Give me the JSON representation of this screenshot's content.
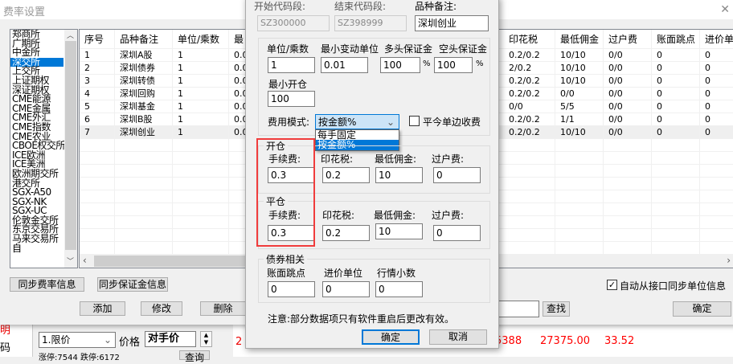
{
  "background": {
    "order_type": "1.限价",
    "price_label": "价格",
    "price_value": "对手价",
    "left_red": "明",
    "left_code": "码",
    "right_number": "2",
    "bottom_values": [
      "5388",
      "27375.00",
      "33.52"
    ],
    "query_label": "查询",
    "bottom_text": "涨停:7544 跌停:6172"
  },
  "window": {
    "title": "费率设置"
  },
  "exchanges": [
    "郑商所",
    "广期所",
    "中金所",
    "深交所",
    "上交所",
    "上证期权",
    "深证期权",
    "CME能源",
    "CME金属",
    "CME外汇",
    "CME指数",
    "CME农业",
    "CBOE权交所",
    "ICE欧洲",
    "ICE美洲",
    "欧洲期交所",
    "港交所",
    "SGX-A50",
    "SGX-NK",
    "SGX-UC",
    "伦敦金交所",
    "东京交易所",
    "马来交易所",
    "自"
  ],
  "selected_exchange": "深交所",
  "table": {
    "headers": [
      "序号",
      "品种备注",
      "单位/乘数",
      "最",
      "印花税",
      "最低佣金",
      "过户费",
      "账面跳点",
      "进价单"
    ],
    "rows": [
      [
        "1",
        "深圳A股",
        "1",
        "0.0",
        "0.2/0.2",
        "10/10",
        "0/0",
        "0",
        "0"
      ],
      [
        "2",
        "深圳债券",
        "1",
        "0.0",
        "2/0.2",
        "10/10",
        "0/0",
        "0",
        "0"
      ],
      [
        "3",
        "深圳转债",
        "1",
        "0.0",
        "0.2/0.2",
        "10/10",
        "0/0",
        "0",
        "0"
      ],
      [
        "4",
        "深圳回购",
        "1",
        "0.0",
        "0.2/0.2",
        "0/0",
        "0/0",
        "0",
        "0"
      ],
      [
        "5",
        "深圳基金",
        "1",
        "0.0",
        "0/0",
        "5/5",
        "0/0",
        "0",
        "0"
      ],
      [
        "6",
        "深圳B股",
        "1",
        "0.0",
        "0.2/0.2",
        "1/1",
        "0/0",
        "0",
        "0"
      ],
      [
        "7",
        "深圳创业",
        "1",
        "0.0",
        "0.2/0.2",
        "10/10",
        "0/0",
        "0",
        "0"
      ]
    ]
  },
  "buttons": {
    "sync_fee": "同步费率信息",
    "sync_margin": "同步保证金信息",
    "add": "添加",
    "modify": "修改",
    "delete": "删除",
    "find": "查找",
    "ok": "确定"
  },
  "auto_sync": {
    "label": "自动从接口同步单位信息",
    "checked": true
  },
  "search": {
    "value": ""
  },
  "dialog": {
    "start_code_label": "开始代码段:",
    "start_code": "SZ300000",
    "end_code_label": "结束代码段:",
    "end_code": "SZ398999",
    "remark_label": "品种备注:",
    "remark": "深圳创业",
    "unit_label": "单位/乘数",
    "unit": "1",
    "tick_label": "最小变动单位",
    "tick": "0.01",
    "long_margin_label": "多头保证金",
    "long_margin": "100",
    "short_margin_label": "空头保证金",
    "short_margin": "100",
    "pct": "%",
    "min_open_label": "最小开仓",
    "min_open": "100",
    "fee_mode_label": "费用模式:",
    "fee_mode": "按金额%",
    "fee_mode_options": [
      "每手固定",
      "按金额%"
    ],
    "close_today_label": "平今单边收费",
    "close_today_checked": false,
    "open": {
      "title": "开仓",
      "fee_label": "手续费:",
      "fee": "0.3",
      "stamp_label": "印花税:",
      "stamp": "0.2",
      "min_comm_label": "最低佣金:",
      "min_comm": "10",
      "transfer_label": "过户费:",
      "transfer": "0"
    },
    "close": {
      "title": "平仓",
      "fee_label": "手续费:",
      "fee": "0.3",
      "stamp_label": "印花税:",
      "stamp": "0.2",
      "min_comm_label": "最低佣金:",
      "min_comm": "10",
      "transfer_label": "过户费:",
      "transfer": "0"
    },
    "bond": {
      "title": "债券相关",
      "tick_label": "账面跳点",
      "tick": "0",
      "price_unit_label": "进价单位",
      "price_unit": "0",
      "decimals_label": "行情小数",
      "decimals": "0"
    },
    "note": "注意:部分数据项只有软件重启后更改有效。",
    "ok": "确定",
    "cancel": "取消"
  },
  "colors": {
    "accent": "#0078d7",
    "highlight_box": "#f03c3c",
    "up": "#ff0000"
  }
}
